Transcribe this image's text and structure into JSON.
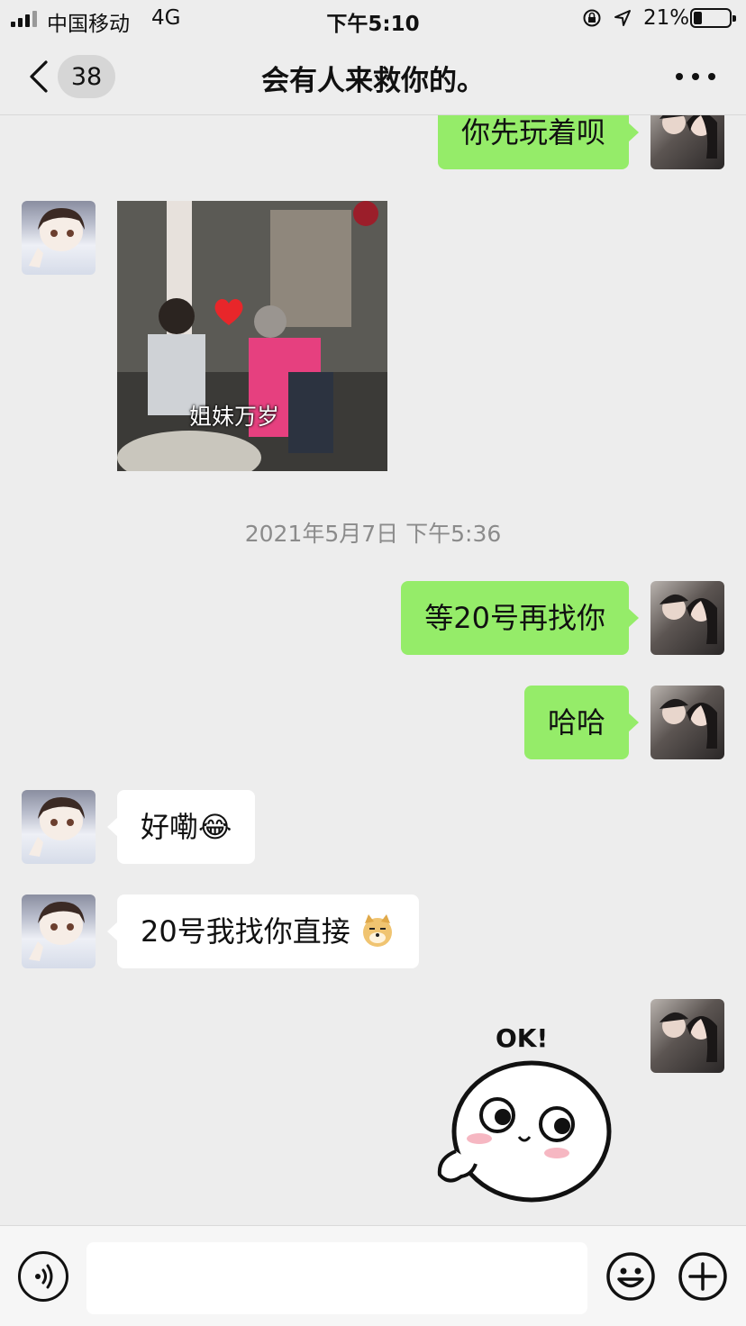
{
  "status_bar": {
    "carrier": "中国移动",
    "network": "4G",
    "time": "下午5:10",
    "battery": "21%"
  },
  "header": {
    "unread_count": "38",
    "title": "会有人来救你的。"
  },
  "messages": [
    {
      "sender": "me",
      "type": "text",
      "text": "你先玩着呗"
    },
    {
      "sender": "friend",
      "type": "image",
      "caption": "姐妹万岁"
    },
    {
      "type": "timestamp",
      "text": "2021年5月7日 下午5:36"
    },
    {
      "sender": "me",
      "type": "text",
      "text": "等20号再找你"
    },
    {
      "sender": "me",
      "type": "text",
      "text": "哈哈"
    },
    {
      "sender": "friend",
      "type": "text",
      "text": "好嘞",
      "emoji": "😂"
    },
    {
      "sender": "friend",
      "type": "text",
      "text": "20号我找你直接",
      "emoji": "dog-face"
    },
    {
      "sender": "me",
      "type": "sticker",
      "text": "OK!"
    }
  ],
  "input": {
    "placeholder": ""
  },
  "colors": {
    "my_bubble": "#95ec69",
    "friend_bubble": "#ffffff",
    "background": "#ededed"
  }
}
